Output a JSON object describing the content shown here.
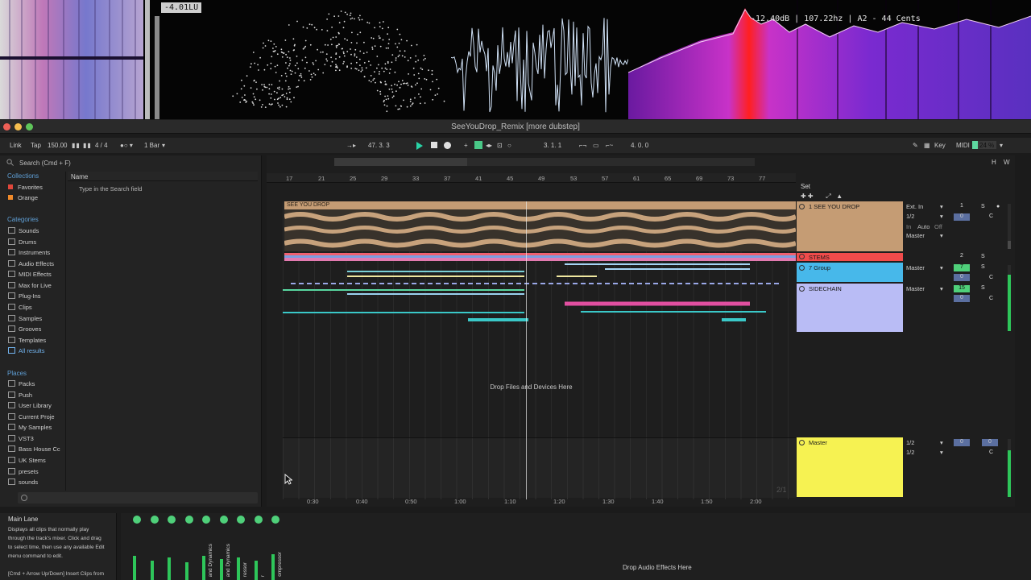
{
  "visualizer": {
    "loudness": "-4.01LU",
    "readout": "-12.40dB | 107.22hz | A2 - 44 Cents"
  },
  "window": {
    "title": "SeeYouDrop_Remix  [more dubstep]"
  },
  "control_bar": {
    "link": "Link",
    "tap": "Tap",
    "tempo": "150.00",
    "time_signature": "4 / 4",
    "quantize": "1 Bar",
    "position": "47.  3.  3",
    "loop_start": "3.  1.  1",
    "loop_length": "4.  0.  0",
    "key": "Key",
    "midi": "MIDI",
    "cpu_percent": "24 %",
    "cpu_value": 0.24,
    "h": "H",
    "w": "W"
  },
  "browser": {
    "search_placeholder": "Search (Cmd + F)",
    "collections_label": "Collections",
    "collections": [
      {
        "label": "Favorites",
        "color": "#e0473b"
      },
      {
        "label": "Orange",
        "color": "#f08a2a"
      }
    ],
    "categories_label": "Categories",
    "categories": [
      "Sounds",
      "Drums",
      "Instruments",
      "Audio Effects",
      "MIDI Effects",
      "Max for Live",
      "Plug-Ins",
      "Clips",
      "Samples",
      "Grooves",
      "Templates",
      "All results"
    ],
    "places_label": "Places",
    "places": [
      "Packs",
      "Push",
      "User Library",
      "Current Proje",
      "My Samples",
      "VST3",
      "Bass House Cc",
      "UK Stems",
      "presets",
      "sounds"
    ],
    "name_column": "Name",
    "hint": "Type in the Search field"
  },
  "arrangement": {
    "bars": [
      "17",
      "21",
      "25",
      "29",
      "33",
      "37",
      "41",
      "45",
      "49",
      "53",
      "57",
      "61",
      "65",
      "69",
      "73",
      "77"
    ],
    "times": [
      "0:30",
      "0:40",
      "0:50",
      "1:00",
      "1:10",
      "1:20",
      "1:30",
      "1:40",
      "1:50",
      "2:00"
    ],
    "set_label": "Set",
    "drop_files": "Drop Files and Devices Here",
    "audio_clip_name": "SEE YOU DROP",
    "page_indicator": "2/1"
  },
  "tracks": [
    {
      "name": "1 SEE YOU DROP",
      "color": "#c59c74",
      "input": "Ext. In",
      "channel": "1/2",
      "monitor": [
        "In",
        "Auto",
        "Off"
      ],
      "output": "Master",
      "number": "1",
      "volume": "0",
      "pan": "C"
    },
    {
      "name": "STEMS",
      "color": "#f04b4b",
      "number": "2"
    },
    {
      "name": "7 Group",
      "color": "#47b8ea",
      "output": "Master",
      "number": "7",
      "volume": "0",
      "pan": "C"
    },
    {
      "name": "SIDECHAIN",
      "color": "#b9bcf5",
      "output": "Master",
      "number": "15",
      "volume": "0",
      "pan": "C"
    }
  ],
  "master": {
    "name": "Master",
    "color": "#f6f252",
    "cue_out": "1/2",
    "main_out": "1/2",
    "volume_a": "0",
    "volume_b": "0",
    "pan": "C"
  },
  "solo_label": "S",
  "info": {
    "title": "Main Lane",
    "body": "Displays all clips that normally play\nthrough the track's mixer. Click and drag\nto select time, then use any available Edit\nmenu command to edit.\n\n[Cmd + Arrow Up/Down] Insert Clips from\nPrevious/Next Take Lane"
  },
  "devices": {
    "labels": [
      "",
      "",
      "",
      "",
      "and Dynamics",
      "and Dynamics",
      "ressor",
      "r",
      "ompressor"
    ],
    "drop_effects": "Drop Audio Effects Here"
  }
}
